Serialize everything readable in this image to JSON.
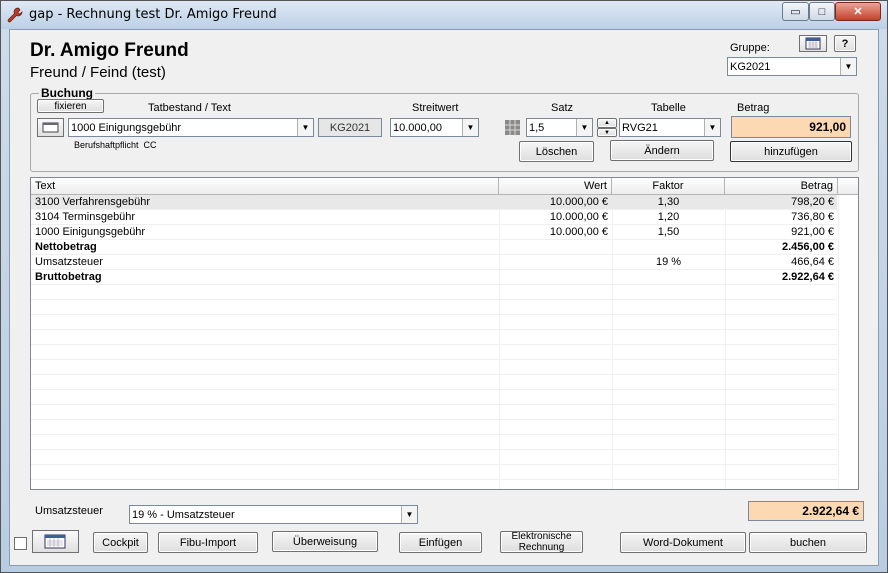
{
  "window": {
    "title": "gap - Rechnung test Dr. Amigo Freund",
    "min_glyph": "▭",
    "max_glyph": "□",
    "close_glyph": "✕"
  },
  "header": {
    "name": "Dr. Amigo Freund",
    "subtitle": "Freund / Feind (test)",
    "gruppe_label": "Gruppe:",
    "gruppe_value": "KG2021",
    "help_label": "?"
  },
  "buchung": {
    "group_title": "Buchung",
    "fixieren_label": "fixieren",
    "tatbestand_label": "Tatbestand / Text",
    "tatbestand_value": "1000 Einigungsgebühr",
    "code_value": "KG2021",
    "streitwert_label": "Streitwert",
    "streitwert_value": "10.000,00",
    "satz_label": "Satz",
    "satz_value": "1,5",
    "tabelle_label": "Tabelle",
    "tabelle_value": "RVG21",
    "betrag_label": "Betrag",
    "betrag_value": "921,00",
    "sub_info": "Berufshaftpflicht  CC",
    "loeschen_label": "Löschen",
    "aendern_label": "Ändern",
    "hinzufuegen_label": "hinzufügen"
  },
  "table": {
    "columns": [
      "Text",
      "Wert",
      "Faktor",
      "Betrag"
    ],
    "rows": [
      {
        "text": "3100 Verfahrensgebühr",
        "wert": "10.000,00 €",
        "faktor": "1,30",
        "betrag": "798,20 €",
        "bold": false
      },
      {
        "text": "3104 Terminsgebühr",
        "wert": "10.000,00 €",
        "faktor": "1,20",
        "betrag": "736,80 €",
        "bold": false
      },
      {
        "text": "1000 Einigungsgebühr",
        "wert": "10.000,00 €",
        "faktor": "1,50",
        "betrag": "921,00 €",
        "bold": false
      },
      {
        "text": "Nettobetrag",
        "wert": "",
        "faktor": "",
        "betrag": "2.456,00 €",
        "bold": true
      },
      {
        "text": "Umsatzsteuer",
        "wert": "",
        "faktor": "19 %",
        "betrag": "466,64 €",
        "bold": false
      },
      {
        "text": "Bruttobetrag",
        "wert": "",
        "faktor": "",
        "betrag": "2.922,64 €",
        "bold": true
      }
    ]
  },
  "footer": {
    "ust_label": "Umsatzsteuer",
    "ust_value": "19 % - Umsatzsteuer",
    "total_value": "2.922,64 €",
    "buttons": {
      "cockpit": "Cockpit",
      "fibu": "Fibu-Import",
      "ueberweisung": "Überweisung",
      "einfuegen": "Einfügen",
      "erechnung": "Elektronische Rechnung",
      "word": "Word-Dokument",
      "buchen": "buchen"
    }
  },
  "glyphs": {
    "dropdown": "▼",
    "spin_up": "▲",
    "spin_down": "▼"
  },
  "colors": {
    "peach": "#fcd9b3",
    "client_bg": "#f0f0f0",
    "title_bg": "#cfdcea"
  }
}
